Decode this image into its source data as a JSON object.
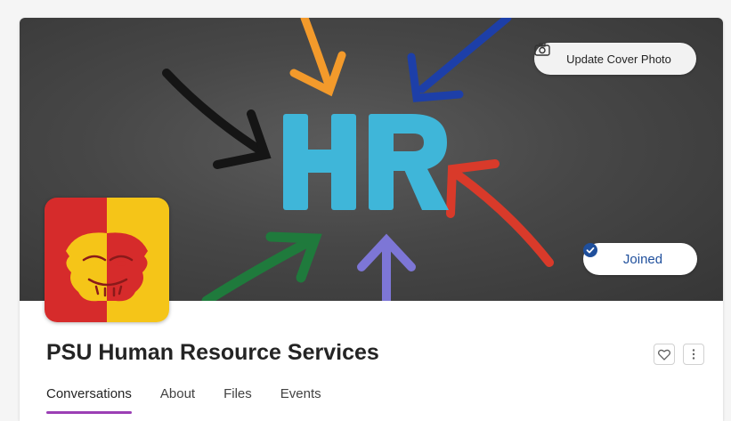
{
  "group": {
    "name": "PSU Human Resource Services",
    "cover_text": "HR"
  },
  "cover": {
    "update_label": "Update Cover Photo",
    "joined_label": "Joined"
  },
  "tabs": [
    {
      "label": "Conversations",
      "active": true
    },
    {
      "label": "About",
      "active": false
    },
    {
      "label": "Files",
      "active": false
    },
    {
      "label": "Events",
      "active": false
    }
  ],
  "colors": {
    "accent_tab": "#9b3fb5",
    "joined_blue": "#1f4f9c",
    "logo_red": "#d62b2b",
    "logo_gold": "#f5c518",
    "hr_letters": "#3fb6d9"
  },
  "icons": {
    "update": "camera-icon",
    "joined": "check-circle-icon",
    "favorite": "heart-icon",
    "more": "more-vertical-icon"
  }
}
